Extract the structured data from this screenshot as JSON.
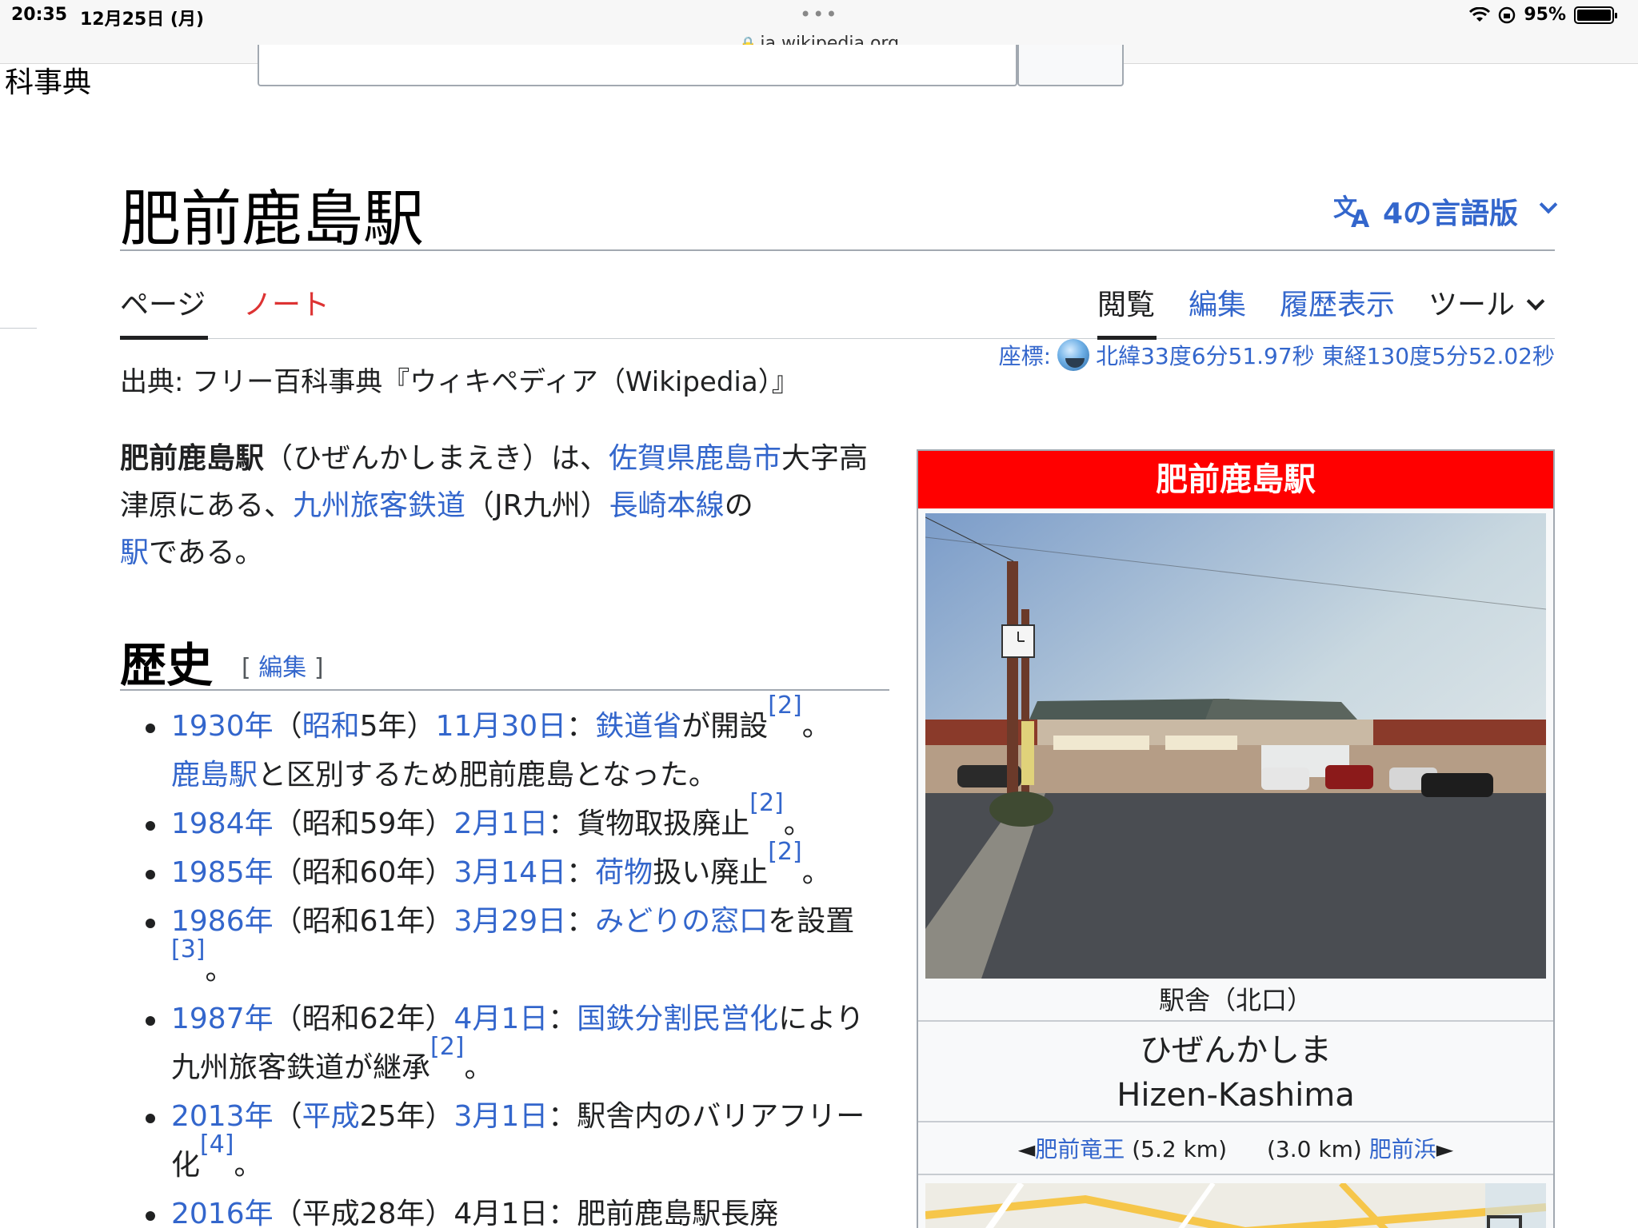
{
  "status": {
    "time": "20:35",
    "date": "12月25日 (月)",
    "dots": "•••",
    "battery": "95%",
    "url": "ja.wikipedia.org"
  },
  "header": {
    "logo_fragment": "科事典"
  },
  "page": {
    "title": "肥前鹿島駅",
    "languages": "4の言語版",
    "tabs": {
      "page": "ページ",
      "talk": "ノート",
      "read": "閲覧",
      "edit": "編集",
      "history": "履歴表示",
      "tools": "ツール"
    },
    "coords": {
      "label": "座標:",
      "value": "北緯33度6分51.97秒 東経130度5分52.02秒"
    },
    "from": "出典: フリー百科事典『ウィキペディア（Wikipedia）』"
  },
  "lead": {
    "bold": "肥前鹿島駅",
    "t1": "（ひぜんかしまえき）は、",
    "l1": "佐賀県",
    "l2": "鹿島市",
    "t2": "大字高津原にある、",
    "l3": "九州旅客鉄道",
    "t3": "（JR九州）",
    "l4": "長崎本線",
    "t4": "の",
    "l5": "駅",
    "t5": "である。"
  },
  "history": {
    "heading": "歴史",
    "edit_open": "[",
    "edit_label": "編集",
    "edit_close": "]",
    "items": [
      {
        "year": "1930年",
        "p1": "（",
        "era": "昭和",
        "p2": "5年）",
        "date": "11月30日",
        "sep": "：",
        "l": "鉄道省",
        "t": "が開設",
        "ref": "[2]",
        "end": "。",
        "l2": "鹿島駅",
        "t2": "と区別するため肥前鹿島となった。"
      },
      {
        "year": "1984年",
        "p": "（昭和59年）",
        "date": "2月1日",
        "t": "：貨物取扱廃止",
        "ref": "[2]",
        "end": "。"
      },
      {
        "year": "1985年",
        "p": "（昭和60年）",
        "date": "3月14日",
        "sep": "：",
        "l": "荷物",
        "t": "扱い廃止",
        "ref": "[2]",
        "end": "。"
      },
      {
        "year": "1986年",
        "p": "（昭和61年）",
        "date": "3月29日",
        "sep": "：",
        "l": "みどりの窓口",
        "t": "を設置",
        "ref": "[3]",
        "end": "。"
      },
      {
        "year": "1987年",
        "p": "（昭和62年）",
        "date": "4月1日",
        "sep": "：",
        "l": "国鉄分割民営化",
        "t": "により九州旅客鉄道が継承",
        "ref": "[2]",
        "end": "。"
      },
      {
        "year": "2013年",
        "p1": "（",
        "era": "平成",
        "p2": "25年）",
        "date": "3月1日",
        "t": "：駅舎内のバリアフリー化",
        "ref": "[4]",
        "end": "。"
      },
      {
        "year": "2016年",
        "t": "（平成28年）4月1日：肥前鹿島駅長廃"
      }
    ]
  },
  "infobox": {
    "title": "肥前鹿島駅",
    "caption": "駅舎（北口）",
    "kana": "ひぜんかしま",
    "roman": "Hizen-Kashima",
    "prev_arrow": "◄",
    "prev_name": "肥前竜王",
    "prev_dist": "(5.2 km)",
    "next_dist": "(3.0 km)",
    "next_name": "肥前浜",
    "next_arrow": "►"
  }
}
